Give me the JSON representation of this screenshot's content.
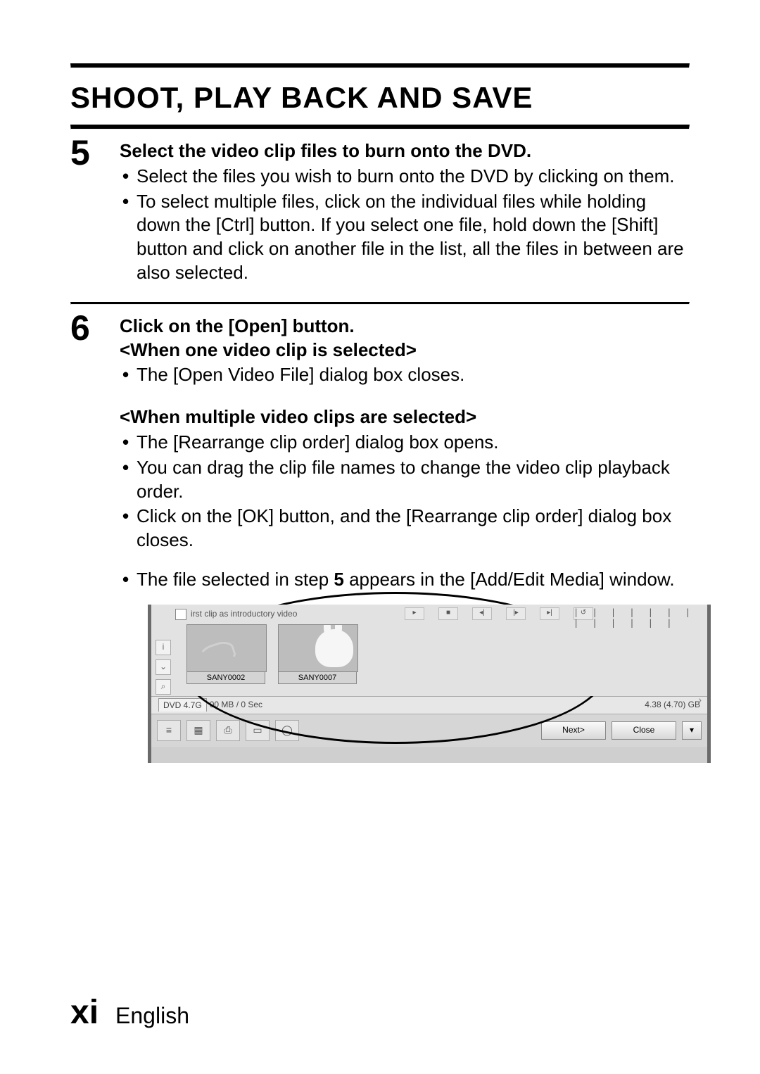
{
  "header": {
    "title": "SHOOT, PLAY BACK AND SAVE"
  },
  "steps": {
    "s5": {
      "num": "5",
      "heading": "Select the video clip files to burn onto the DVD.",
      "b1": "Select the files you wish to burn onto the DVD by clicking on them.",
      "b2": "To select multiple files, click on the individual files while holding down the [Ctrl] button. If you select one file, hold down the [Shift] button and click on another file in the list, all the files in between are also selected."
    },
    "s6": {
      "num": "6",
      "heading_line1": "Click on the [Open] button.",
      "heading_line2": "<When one video clip is selected>",
      "a1": "The [Open Video File] dialog box closes.",
      "sub2": "<When multiple video clips are selected>",
      "b1": "The [Rearrange clip order] dialog box opens.",
      "b2": "You can drag the clip file names to change the video clip playback order.",
      "b3": "Click on the [OK] button, and the [Rearrange clip order] dialog box closes.",
      "final_pre": "The file selected in step ",
      "final_bold": "5",
      "final_post": " appears in the [Add/Edit Media] window."
    }
  },
  "screenshot": {
    "intro_checkbox_label": "irst clip as introductory video",
    "side_info": "i",
    "side_down": "⌄",
    "side_search": "⌕",
    "play_prev": "◂|",
    "play_next": "|▸",
    "play_end": "▸|",
    "play_loop": "↺",
    "play_play": "▸",
    "play_stop": "■",
    "ticks": "| | | | | | | | | | | | |",
    "clip1": "SANY0002",
    "clip2": "SANY0007",
    "dvd_tab": "DVD 4.7G",
    "usage": "00 MB / 0 Sec",
    "capacity": "4.38 (4.70) GB",
    "tool1": "≡",
    "tool2": "▦",
    "tool3": "⎙",
    "tool4": "▭",
    "tool5": "◯",
    "next": "Next>",
    "close": "Close",
    "dd": "▾",
    "arrow_right": "›"
  },
  "footer": {
    "page": "xi",
    "lang": "English"
  }
}
